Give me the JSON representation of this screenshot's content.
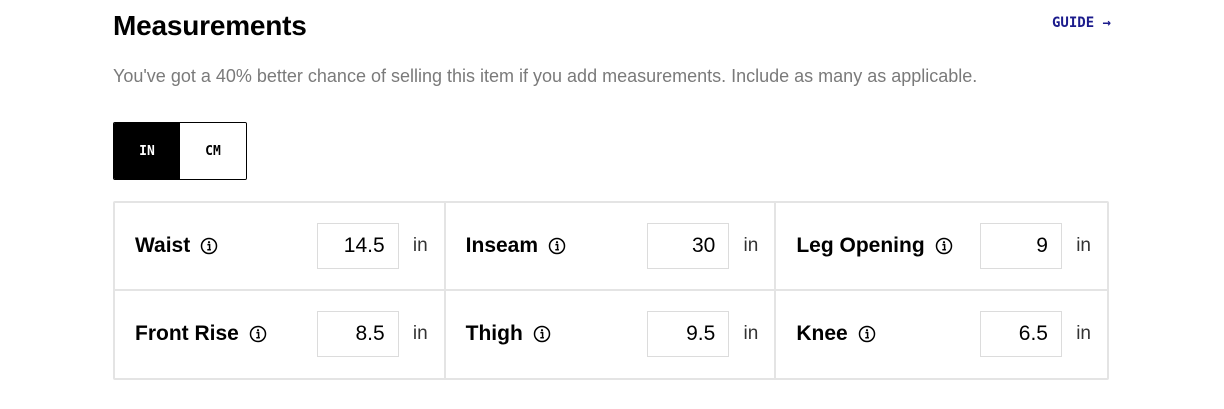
{
  "header": {
    "title": "Measurements",
    "guide_label": "GUIDE →",
    "subtitle": "You've got a 40% better chance of selling this item if you add measurements. Include as many as applicable."
  },
  "unit_toggle": {
    "options": [
      "IN",
      "CM"
    ],
    "selected": "IN"
  },
  "measurements": [
    {
      "label": "Waist",
      "value": "14.5",
      "unit": "in"
    },
    {
      "label": "Inseam",
      "value": "30",
      "unit": "in"
    },
    {
      "label": "Leg Opening",
      "value": "9",
      "unit": "in"
    },
    {
      "label": "Front Rise",
      "value": "8.5",
      "unit": "in"
    },
    {
      "label": "Thigh",
      "value": "9.5",
      "unit": "in"
    },
    {
      "label": "Knee",
      "value": "6.5",
      "unit": "in"
    }
  ],
  "colors": {
    "guide_link": "#1b1b8c",
    "subtitle_text": "#7a7a7a",
    "border": "#e4e4e4",
    "toggle_active_bg": "#000000"
  }
}
